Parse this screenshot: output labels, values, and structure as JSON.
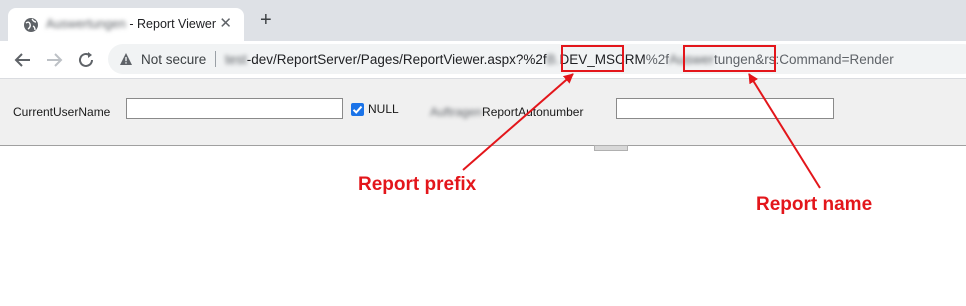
{
  "browser": {
    "tab": {
      "title_prefix": "Auswertungen",
      "title_suffix": " - Report Viewer",
      "close_glyph": "✕"
    },
    "new_tab_glyph": "+",
    "address_bar": {
      "security_label": "Not secure",
      "url_host_blur": "test",
      "url_path": "-dev/ReportServer/Pages/ReportViewer.aspx?%2f",
      "url_prefix_blur": "B.",
      "url_prefix_visible": "DEV_MSCRM",
      "url_mid": "%2f",
      "url_name_blur": "Auswer",
      "url_name_visible": "tungen",
      "url_tail": "&rs:Command=Render"
    }
  },
  "report_params": {
    "current_user_label": "CurrentUserName",
    "current_user_value": "",
    "null_label": "NULL",
    "null_checked": true,
    "autonumber_label_blur": "Auftragen",
    "autonumber_label_visible": "ReportAutonumber",
    "autonumber_value": ""
  },
  "annotations": {
    "prefix_label": "Report prefix",
    "name_label": "Report name",
    "color": "#e3161b"
  },
  "icons": [
    "globe-icon",
    "close-icon",
    "plus-icon",
    "back-arrow-icon",
    "forward-arrow-icon",
    "reload-icon",
    "warning-icon"
  ]
}
